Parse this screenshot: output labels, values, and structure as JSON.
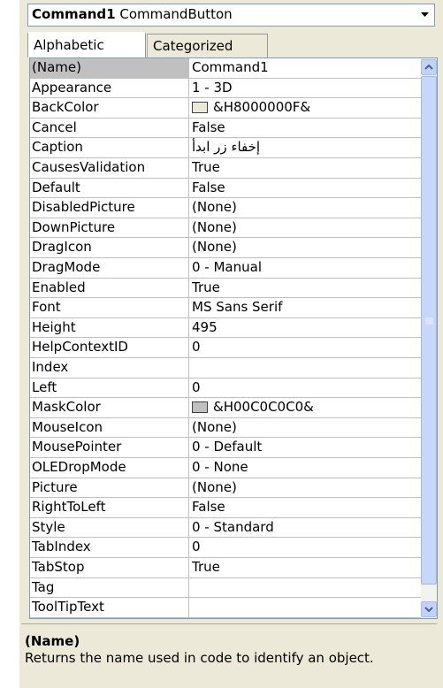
{
  "object_selector": {
    "name": "Command1",
    "type": "CommandButton"
  },
  "tabs": [
    {
      "label": "Alphabetic",
      "active": true
    },
    {
      "label": "Categorized",
      "active": false
    }
  ],
  "properties": [
    {
      "name": "(Name)",
      "value": "Command1",
      "selected": true
    },
    {
      "name": "Appearance",
      "value": "1 - 3D"
    },
    {
      "name": "BackColor",
      "value": "&H8000000F&",
      "swatch": "#ece9d8"
    },
    {
      "name": "Cancel",
      "value": "False"
    },
    {
      "name": "Caption",
      "value": "إخفاء زر ابدأ"
    },
    {
      "name": "CausesValidation",
      "value": "True"
    },
    {
      "name": "Default",
      "value": "False"
    },
    {
      "name": "DisabledPicture",
      "value": "(None)"
    },
    {
      "name": "DownPicture",
      "value": "(None)"
    },
    {
      "name": "DragIcon",
      "value": "(None)"
    },
    {
      "name": "DragMode",
      "value": "0 - Manual"
    },
    {
      "name": "Enabled",
      "value": "True"
    },
    {
      "name": "Font",
      "value": "MS Sans Serif"
    },
    {
      "name": "Height",
      "value": "495"
    },
    {
      "name": "HelpContextID",
      "value": "0"
    },
    {
      "name": "Index",
      "value": ""
    },
    {
      "name": "Left",
      "value": "0"
    },
    {
      "name": "MaskColor",
      "value": "&H00C0C0C0&",
      "swatch": "#c0c0c0"
    },
    {
      "name": "MouseIcon",
      "value": "(None)"
    },
    {
      "name": "MousePointer",
      "value": "0 - Default"
    },
    {
      "name": "OLEDropMode",
      "value": "0 - None"
    },
    {
      "name": "Picture",
      "value": "(None)"
    },
    {
      "name": "RightToLeft",
      "value": "False"
    },
    {
      "name": "Style",
      "value": "0 - Standard"
    },
    {
      "name": "TabIndex",
      "value": "0"
    },
    {
      "name": "TabStop",
      "value": "True"
    },
    {
      "name": "Tag",
      "value": ""
    },
    {
      "name": "ToolTipText",
      "value": ""
    }
  ],
  "description": {
    "title": "(Name)",
    "text": "Returns the name used in code to identify an object."
  },
  "icons": {
    "combo": "chevron-down-icon",
    "scroll_up": "scroll-up-arrow-icon",
    "scroll_down": "scroll-down-arrow-icon",
    "grip": "scroll-grip-icon"
  }
}
